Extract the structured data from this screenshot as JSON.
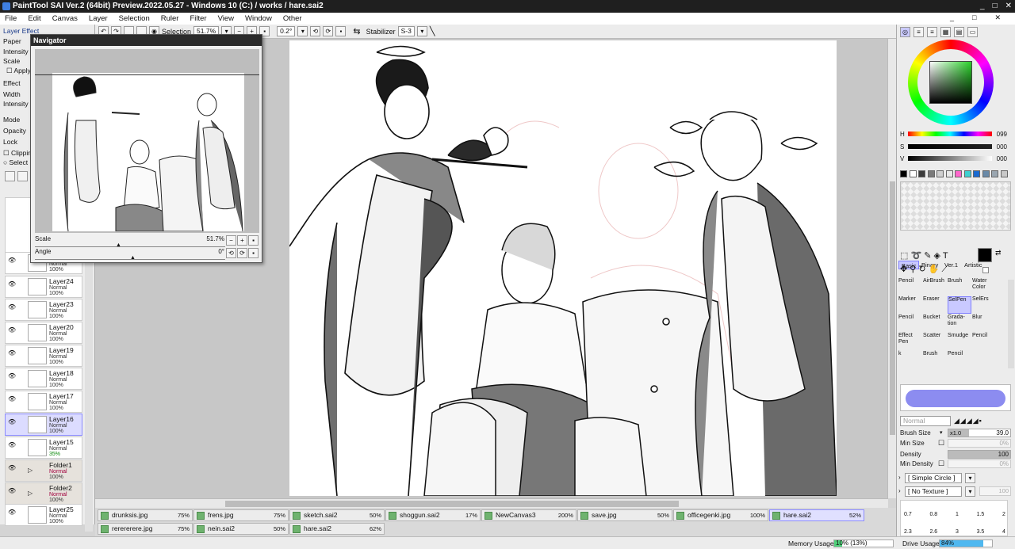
{
  "window": {
    "title": "PaintTool SAI Ver.2 (64bit) Preview.2022.05.27 - Windows 10 (C:) / works / hare.sai2",
    "controls": [
      "_",
      "□",
      "✕"
    ]
  },
  "menu": [
    "File",
    "Edit",
    "Canvas",
    "Layer",
    "Selection",
    "Ruler",
    "Filter",
    "View",
    "Window",
    "Other"
  ],
  "toolbar": {
    "selection_label": "Selection",
    "zoom": "51.7%",
    "angle": "0.2°",
    "stabilizer_label": "Stabilizer",
    "stabilizer_value": "S-3"
  },
  "left_panel": {
    "header": "Layer Effect",
    "labels": [
      "Paper",
      "Intensity",
      "Scale",
      "Apply",
      "Effect",
      "Width",
      "Intensity",
      "Mode",
      "Opacity",
      "Lock",
      "Clipping",
      "Select"
    ]
  },
  "navigator": {
    "title": "Navigator",
    "scale_label": "Scale",
    "scale_value": "51.7%",
    "angle_label": "Angle",
    "angle_value": "0°"
  },
  "layers": [
    {
      "name": "",
      "mode": "Normal",
      "opacity": "100%"
    },
    {
      "name": "Layer24",
      "mode": "Normal",
      "opacity": "100%"
    },
    {
      "name": "Layer23",
      "mode": "Normal",
      "opacity": "100%"
    },
    {
      "name": "Layer20",
      "mode": "Normal",
      "opacity": "100%"
    },
    {
      "name": "Layer19",
      "mode": "Normal",
      "opacity": "100%"
    },
    {
      "name": "Layer18",
      "mode": "Normal",
      "opacity": "100%"
    },
    {
      "name": "Layer17",
      "mode": "Normal",
      "opacity": "100%"
    },
    {
      "name": "Layer16",
      "mode": "Normal",
      "opacity": "100%"
    },
    {
      "name": "Layer15",
      "mode": "Normal",
      "opacity": "35%"
    },
    {
      "name": "Folder1",
      "mode": "Normal",
      "opacity": "100%"
    },
    {
      "name": "Folder2",
      "mode": "Normal",
      "opacity": "100%"
    },
    {
      "name": "Layer25",
      "mode": "Normal",
      "opacity": "100%"
    }
  ],
  "file_tabs": [
    {
      "name": "drunksis.jpg",
      "pct": "75%"
    },
    {
      "name": "frens.jpg",
      "pct": "75%"
    },
    {
      "name": "sketch.sai2",
      "pct": "50%"
    },
    {
      "name": "shoggun.sai2",
      "pct": "17%"
    },
    {
      "name": "NewCanvas3",
      "pct": "200%"
    },
    {
      "name": "save.jpg",
      "pct": "50%"
    },
    {
      "name": "officegenki.jpg",
      "pct": "100%"
    },
    {
      "name": "hare.sai2",
      "pct": "52%"
    },
    {
      "name": "rerererere.jpg",
      "pct": "75%"
    },
    {
      "name": "nein.sai2",
      "pct": "50%"
    },
    {
      "name": "hare.sai2",
      "pct": "62%"
    }
  ],
  "status": {
    "memory_label": "Memory Usage",
    "memory_value": "10% (13%)",
    "memory_fraction": 0.13,
    "drive_label": "Drive Usage",
    "drive_value": "84%",
    "drive_fraction": 0.84
  },
  "color": {
    "h_label": "H",
    "h_value": "099",
    "s_label": "S",
    "s_value": "000",
    "v_label": "V",
    "v_value": "000",
    "swatches": [
      "#000000",
      "#ffffff",
      "#3a3a3a",
      "#7a7a7a",
      "#cfcfcf",
      "#e8e8e8",
      "#ff66cc",
      "#3fd0d0",
      "#1a6ad0",
      "#6a8aa8",
      "#9aa6b0",
      "#c8c8c8"
    ]
  },
  "tool_tabs": [
    "Basic",
    "Binary",
    "Ver.1",
    "Artistic"
  ],
  "tools": [
    [
      "Pencil",
      "AirBrush",
      "Brush",
      "Water Color"
    ],
    [
      "Marker",
      "Eraser",
      "SelPen",
      "SelErs"
    ],
    [
      "Pencil",
      "Bucket",
      "Grada-tion",
      "Blur"
    ],
    [
      "Effect Pen",
      "Scatter",
      "Smudge",
      "Pencil"
    ],
    [
      "k",
      "Brush",
      "Pencil",
      ""
    ]
  ],
  "brush": {
    "mode": "Normal",
    "size_label": "Brush Size",
    "size_mult": "x1.0",
    "size_value": "39.0",
    "min_size_label": "Min Size",
    "min_size_value": "0%",
    "density_label": "Density",
    "density_value": "100",
    "min_density_label": "Min Density",
    "min_density_value": "0%",
    "shape": "[ Simple Circle ]",
    "texture": "[ No Texture ]",
    "texture_value": "100",
    "sizes_row1": [
      "0.7",
      "0.8",
      "1",
      "1.5",
      "2"
    ],
    "sizes_row2": [
      "2.3",
      "2.6",
      "3",
      "3.5",
      "4"
    ]
  }
}
